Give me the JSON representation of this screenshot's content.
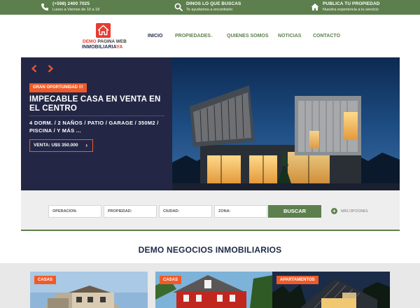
{
  "topbar": {
    "phone": {
      "title": "(+598) 2400 7025",
      "sub": "Lunes a Viernes de 10 a 18"
    },
    "search": {
      "title": "DINOS LO QUE BUSCAS",
      "sub": "Te ayudamos a encontrarlo"
    },
    "publish": {
      "title": "PUBLICA TU PROPIEDAD",
      "sub": "Nuestra experiencia a tu servicio"
    }
  },
  "logo": {
    "demo": "DEMO",
    "pagina_web": "PAGINA WEB",
    "brand": "INMOBILIARIA",
    "ya": "YA"
  },
  "nav": {
    "inicio": "INICIO",
    "propiedades": "PROPIEDADES",
    "quienes": "QUIENES SOMOS",
    "noticias": "NOTICIAS",
    "contacto": "CONTACTO"
  },
  "hero": {
    "badge": "GRAN OPORTUNIDAD !!!",
    "title": "IMPECABLE CASA EN VENTA EN EL CENTRO",
    "features": "4 DORM. / 2 NAÑOS / PATIO / GARAGE / 350M2 / PISCINA / Y MÁS ...",
    "price": "VENTA: U$S 350.000"
  },
  "search": {
    "operacion": "OPERACION:",
    "propiedad": "PROPIEDAD:",
    "ciudad": "CIUDAD:",
    "zona": "ZONA:",
    "button": "BUSCAR",
    "more": "MÁS OPCIONES"
  },
  "section": {
    "title": "DEMO NEGOCIOS INMOBILIARIOS"
  },
  "cards": [
    {
      "badge": "CASAS"
    },
    {
      "badge": "CASAS"
    },
    {
      "badge": "APARTAMENTOS"
    }
  ],
  "colors": {
    "green": "#5d7f4d",
    "navy": "#232745",
    "orange": "#f05a28",
    "red": "#e63c2f"
  }
}
